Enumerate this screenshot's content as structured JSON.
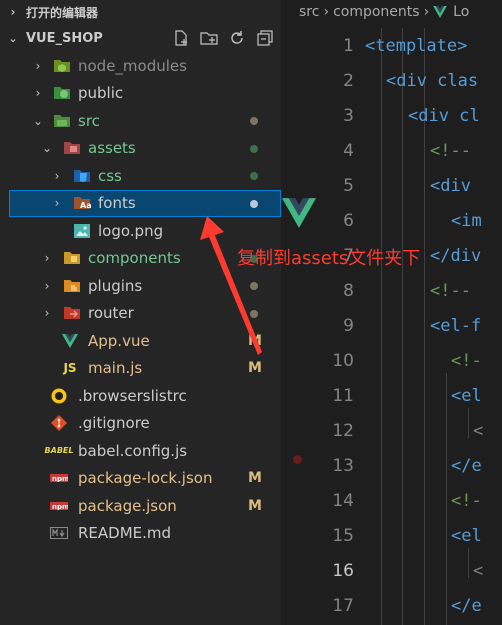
{
  "sidebar": {
    "open_editors": "打开的编辑器",
    "workspace": "VUE_SHOP",
    "actions": [
      "new-file-icon",
      "new-folder-icon",
      "refresh-icon",
      "collapse-all-icon"
    ],
    "tree": [
      {
        "name": "node_modules",
        "type": "folder",
        "expanded": false,
        "color": "gray"
      },
      {
        "name": "public",
        "type": "folder",
        "expanded": false,
        "color": "white"
      },
      {
        "name": "src",
        "type": "folder",
        "expanded": true,
        "color": "green"
      },
      {
        "name": "assets",
        "type": "folder",
        "expanded": true,
        "color": "green"
      },
      {
        "name": "css",
        "type": "folder",
        "expanded": false,
        "color": "green"
      },
      {
        "name": "fonts",
        "type": "folder",
        "expanded": false,
        "selected": true,
        "color": "white"
      },
      {
        "name": "logo.png",
        "type": "file",
        "color": "white"
      },
      {
        "name": "components",
        "type": "folder",
        "expanded": false,
        "color": "green"
      },
      {
        "name": "plugins",
        "type": "folder",
        "expanded": false,
        "color": "white"
      },
      {
        "name": "router",
        "type": "folder",
        "expanded": false,
        "color": "white"
      },
      {
        "name": "App.vue",
        "type": "file",
        "status": "M",
        "color": "yellow"
      },
      {
        "name": "main.js",
        "type": "file",
        "status": "M",
        "color": "yellow"
      },
      {
        "name": ".browserslistrc",
        "type": "file",
        "color": "white"
      },
      {
        "name": ".gitignore",
        "type": "file",
        "color": "white"
      },
      {
        "name": "babel.config.js",
        "type": "file",
        "color": "white"
      },
      {
        "name": "package-lock.json",
        "type": "file",
        "status": "M",
        "color": "yellow"
      },
      {
        "name": "package.json",
        "type": "file",
        "status": "M",
        "color": "yellow"
      },
      {
        "name": "README.md",
        "type": "file",
        "color": "white"
      }
    ]
  },
  "editor": {
    "breadcrumb": [
      "src",
      "components",
      "Lo"
    ],
    "current_line": 16,
    "lines": [
      {
        "n": "1",
        "text": "<template>"
      },
      {
        "n": "2",
        "text": "<div clas"
      },
      {
        "n": "3",
        "text": "<div cl"
      },
      {
        "n": "4",
        "text": "<!--"
      },
      {
        "n": "5",
        "text": "<div"
      },
      {
        "n": "6",
        "text": "<im"
      },
      {
        "n": "7",
        "text": "</div"
      },
      {
        "n": "8",
        "text": "<!--"
      },
      {
        "n": "9",
        "text": "<el-f"
      },
      {
        "n": "10",
        "text": "<!-"
      },
      {
        "n": "11",
        "text": "<el"
      },
      {
        "n": "12",
        "text": "<"
      },
      {
        "n": "13",
        "text": "</e"
      },
      {
        "n": "14",
        "text": "<!-"
      },
      {
        "n": "15",
        "text": "<el"
      },
      {
        "n": "16",
        "text": "<"
      },
      {
        "n": "17",
        "text": "</e"
      }
    ]
  },
  "annotation": {
    "text": "复制到assets文件夹下",
    "color": "#ff3b30"
  },
  "colors": {
    "sidebar_bg": "#252526",
    "editor_bg": "#1e1e1e",
    "selection": "#094771",
    "vue_green": "#41b883"
  }
}
